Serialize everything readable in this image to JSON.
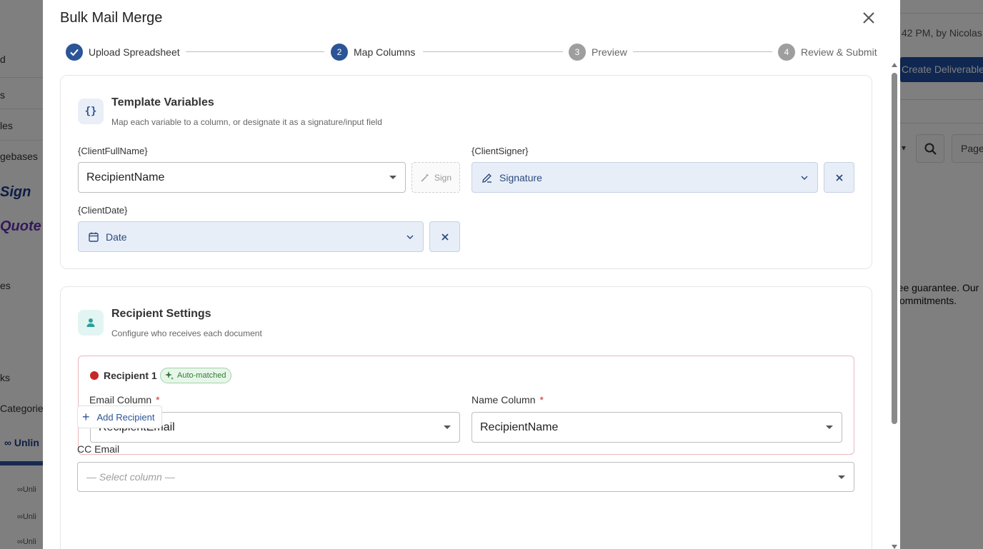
{
  "background": {
    "left_items": [
      "d",
      "s",
      "les",
      "gebases",
      "es",
      "ks",
      "Categories"
    ],
    "left_logo_sign": "Sign",
    "left_logo_quote": "Quote",
    "left_unlimited": "Unlin",
    "left_sub_items": [
      "Unli",
      "Unli",
      "Unli"
    ],
    "right_meta": "42 PM, by Nicolas",
    "right_create_button": "Create Deliverable",
    "right_page_label": "Page",
    "right_paragraph_line1": "ree guarantee. Our",
    "right_paragraph_line2": "commitments."
  },
  "modal": {
    "title": "Bulk Mail Merge",
    "close_label": "×"
  },
  "stepper": {
    "steps": [
      {
        "number": "1",
        "label": "Upload Spreadsheet",
        "state": "done"
      },
      {
        "number": "2",
        "label": "Map Columns",
        "state": "active"
      },
      {
        "number": "3",
        "label": "Preview",
        "state": "todo"
      },
      {
        "number": "4",
        "label": "Review & Submit",
        "state": "todo"
      }
    ]
  },
  "template_variables": {
    "title": "Template Variables",
    "subtitle": "Map each variable to a column, or designate it as a signature/input field",
    "icon_glyph": "{}",
    "vars": [
      {
        "label": "{ClientFullName}",
        "value": "RecipientName",
        "sign_label": "Sign"
      },
      {
        "label": "{ClientSigner}",
        "value": "Signature"
      },
      {
        "label": "{ClientDate}",
        "value": "Date"
      }
    ]
  },
  "recipient_settings": {
    "title": "Recipient Settings",
    "subtitle": "Configure who receives each document",
    "recipient": {
      "name": "Recipient 1",
      "badge": "Auto-matched",
      "email_label": "Email Column",
      "email_value": "RecipientEmail",
      "name_label": "Name Column",
      "name_value": "RecipientName",
      "required_mark": "*"
    },
    "add_recipient": "Add Recipient",
    "add_recipient_plus": "+",
    "cc_label": "CC Email",
    "cc_placeholder": "— Select column —"
  },
  "colors": {
    "primary": "#2b5597",
    "step_inactive": "#9e9e9e",
    "filled_bg": "#e8eef8",
    "recipient_dot": "#c62828",
    "badge_green": "#2e7d32",
    "required": "#d32f2f"
  }
}
